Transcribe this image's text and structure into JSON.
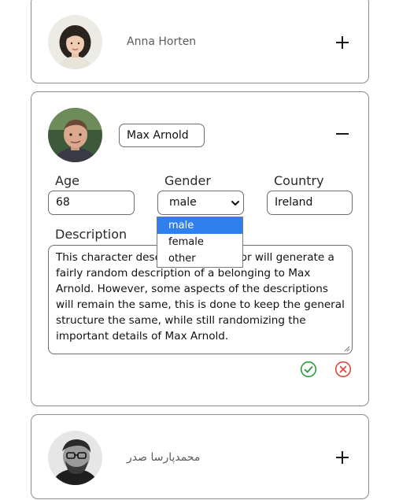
{
  "cards": [
    {
      "name": "Anna Horten",
      "avatar_icon": "person-photo-icon",
      "toggle_icon": "plus-icon"
    },
    {
      "name": "Max Arnold",
      "avatar_icon": "person-photo-icon",
      "toggle_icon": "minus-icon",
      "labels": {
        "age": "Age",
        "gender": "Gender",
        "country": "Country",
        "description": "Description"
      },
      "age": "68",
      "gender_selected": "male",
      "country": "Ireland",
      "gender_options": [
        "male",
        "female",
        "other"
      ],
      "description": "This character description generator will generate a fairly random description of a belonging to Max Arnold. However, some aspects of the descriptions will remain the same, this is done to keep the general structure the same, while still randomizing the important details of Max Arnold.",
      "confirm_icon": "check-circle-icon",
      "cancel_icon": "x-circle-icon",
      "colors": {
        "confirm": "#2e9b3a",
        "cancel": "#e0453b",
        "selected_option": "#2f80ed"
      }
    },
    {
      "name": "محمدپارسا صدر",
      "avatar_icon": "person-photo-icon",
      "toggle_icon": "plus-icon"
    }
  ]
}
